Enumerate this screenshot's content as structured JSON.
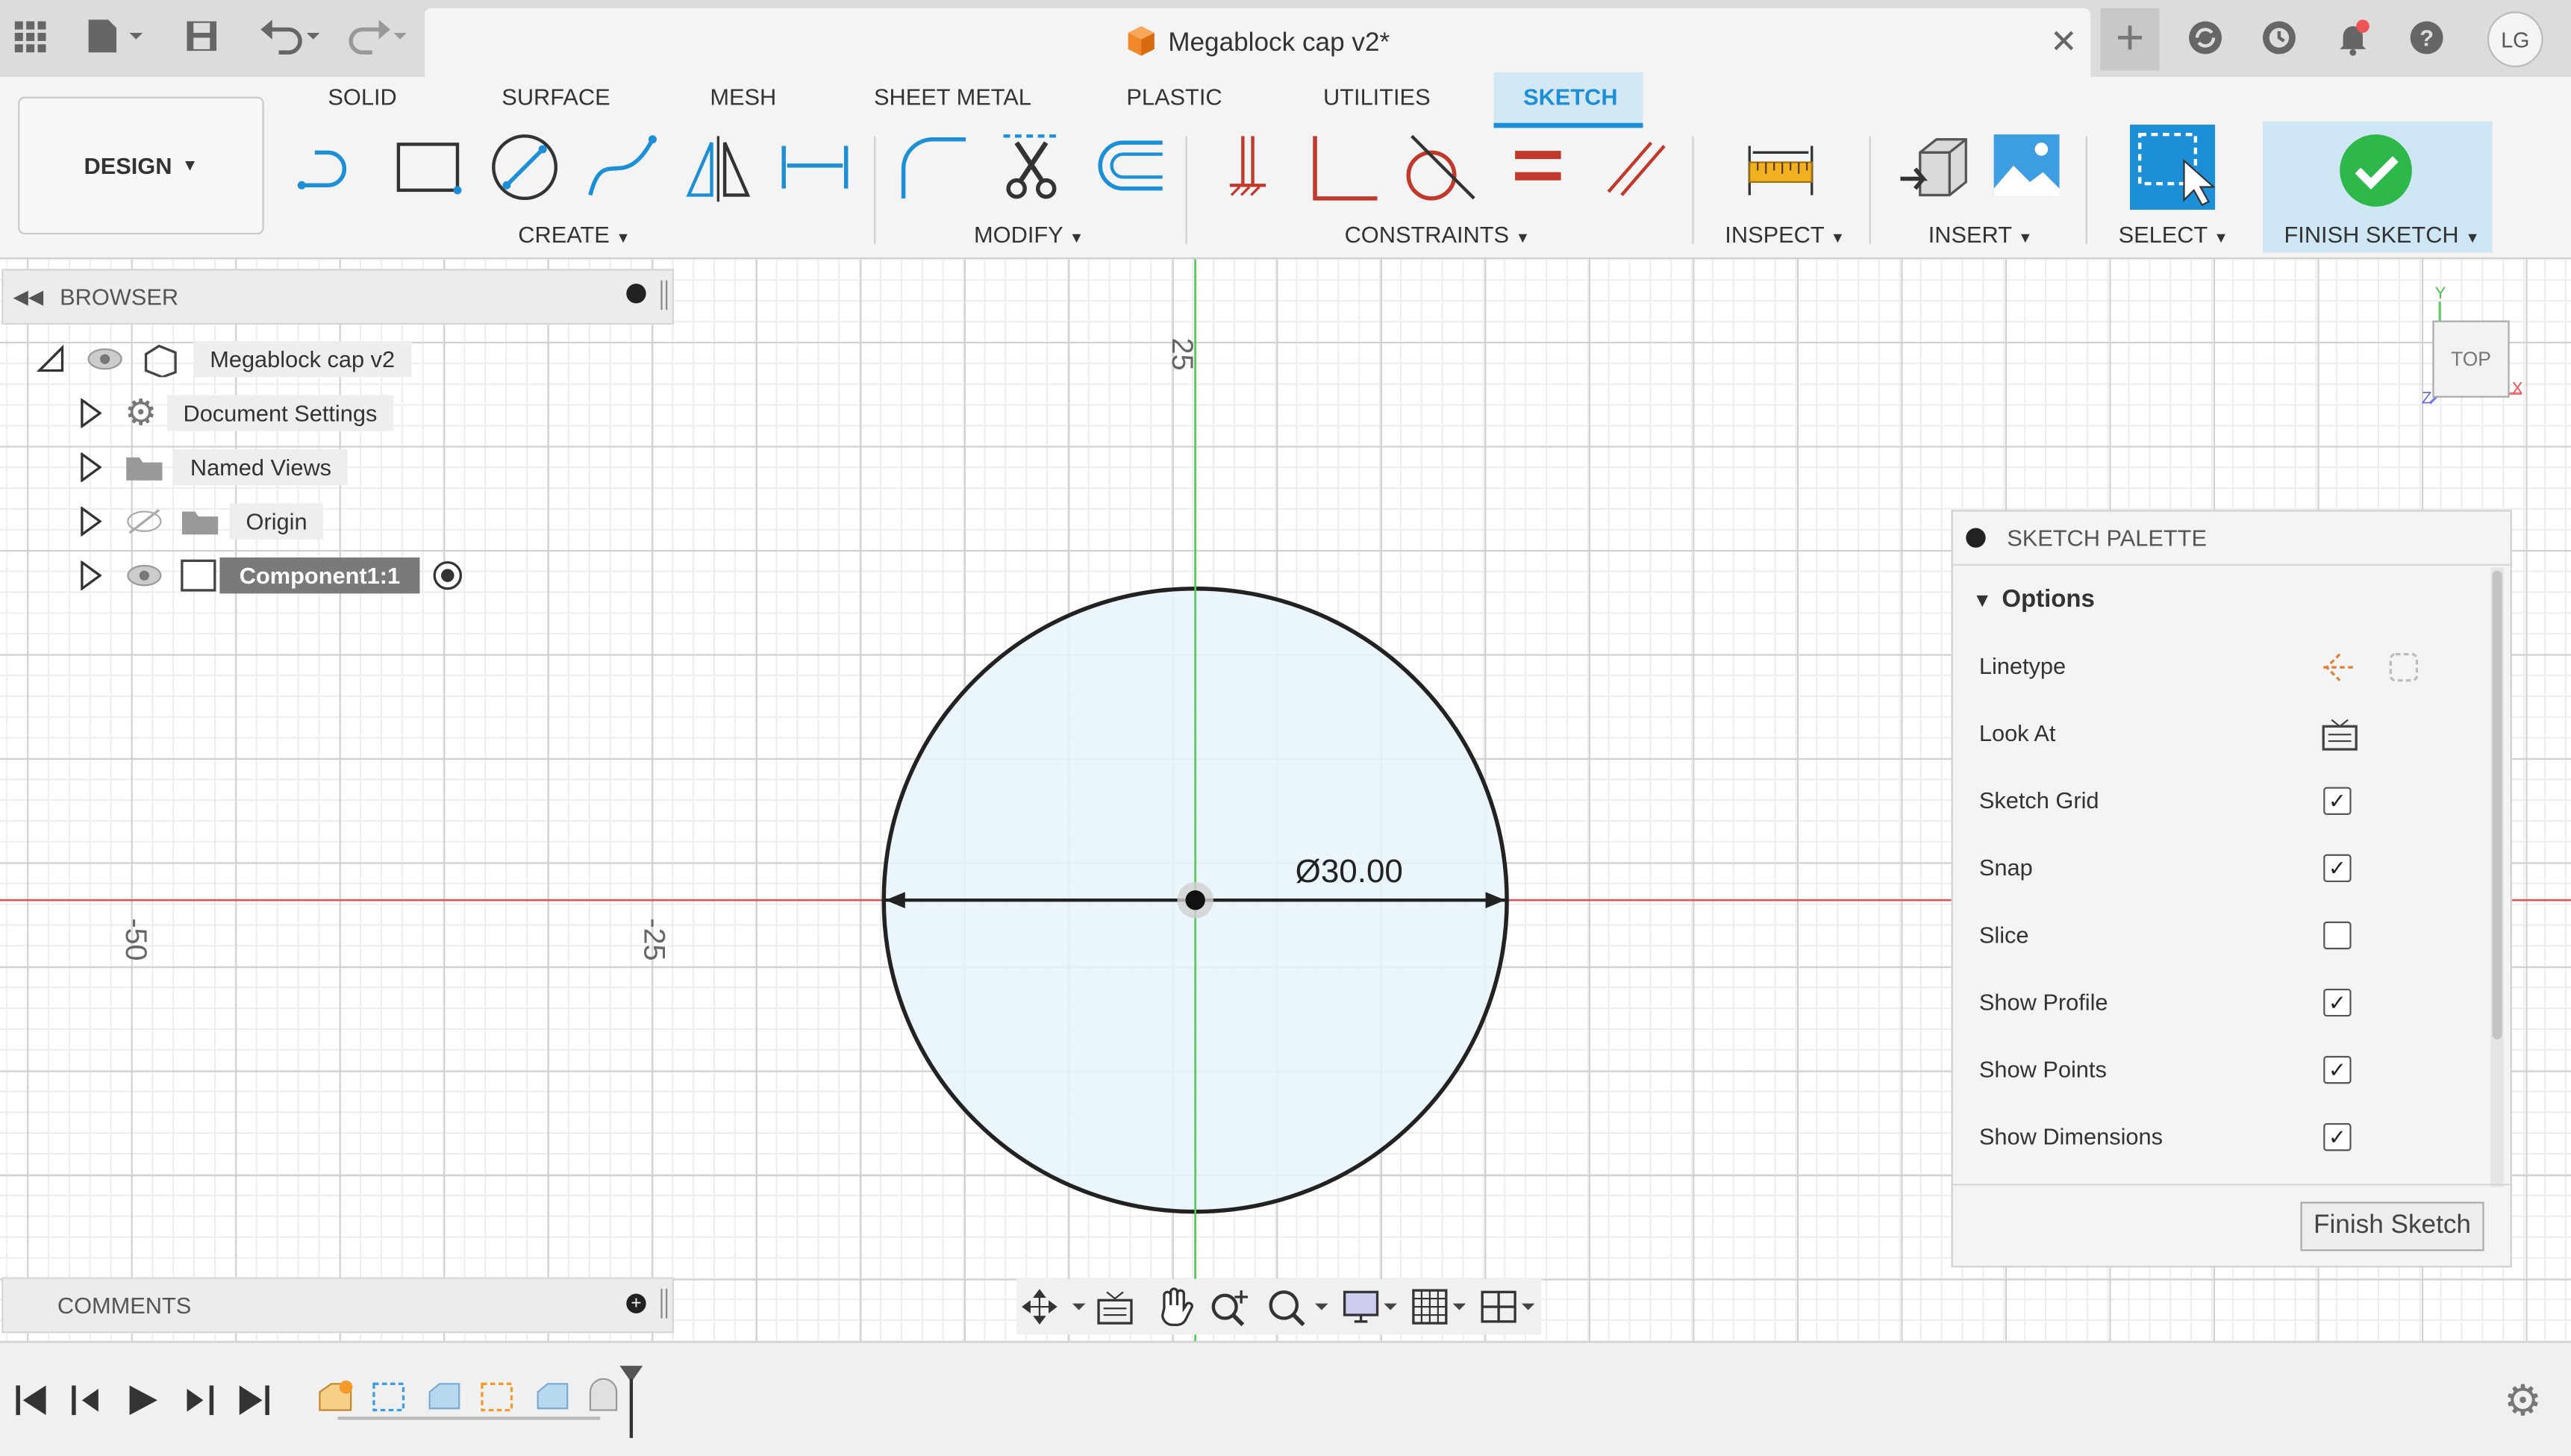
{
  "app": {
    "document_title": "Megablock cap v2*",
    "user_initials": "LG"
  },
  "workspace": {
    "label": "DESIGN"
  },
  "ribbon_tabs": [
    "SOLID",
    "SURFACE",
    "MESH",
    "SHEET METAL",
    "PLASTIC",
    "UTILITIES",
    "SKETCH"
  ],
  "active_tab": "SKETCH",
  "groups": {
    "create": "CREATE",
    "modify": "MODIFY",
    "constraints": "CONSTRAINTS",
    "inspect": "INSPECT",
    "insert": "INSERT",
    "select": "SELECT",
    "finish": "FINISH SKETCH"
  },
  "browser": {
    "title": "BROWSER",
    "root": "Megablock cap v2",
    "items": [
      "Document Settings",
      "Named Views",
      "Origin",
      "Component1:1"
    ]
  },
  "comments": {
    "title": "COMMENTS"
  },
  "viewcube": {
    "face": "TOP",
    "axis_x": "X",
    "axis_y": "Y",
    "axis_z": "Z"
  },
  "canvas": {
    "dimension_label": "Ø30.00",
    "ruler_labels": [
      "25",
      "-50",
      "-25"
    ]
  },
  "palette": {
    "title": "SKETCH PALETTE",
    "section": "Options",
    "rows": [
      {
        "label": "Linetype"
      },
      {
        "label": "Look At"
      },
      {
        "label": "Sketch Grid",
        "checked": true
      },
      {
        "label": "Snap",
        "checked": true
      },
      {
        "label": "Slice",
        "checked": false
      },
      {
        "label": "Show Profile",
        "checked": true
      },
      {
        "label": "Show Points",
        "checked": true
      },
      {
        "label": "Show Dimensions",
        "checked": true
      }
    ],
    "finish_button": "Finish Sketch"
  },
  "colors": {
    "accent": "#1d8fd6",
    "x_axis": "#e05555",
    "y_axis": "#55cc55",
    "profile_fill": "#e8f3fb",
    "finish_green": "#2fb84a"
  }
}
